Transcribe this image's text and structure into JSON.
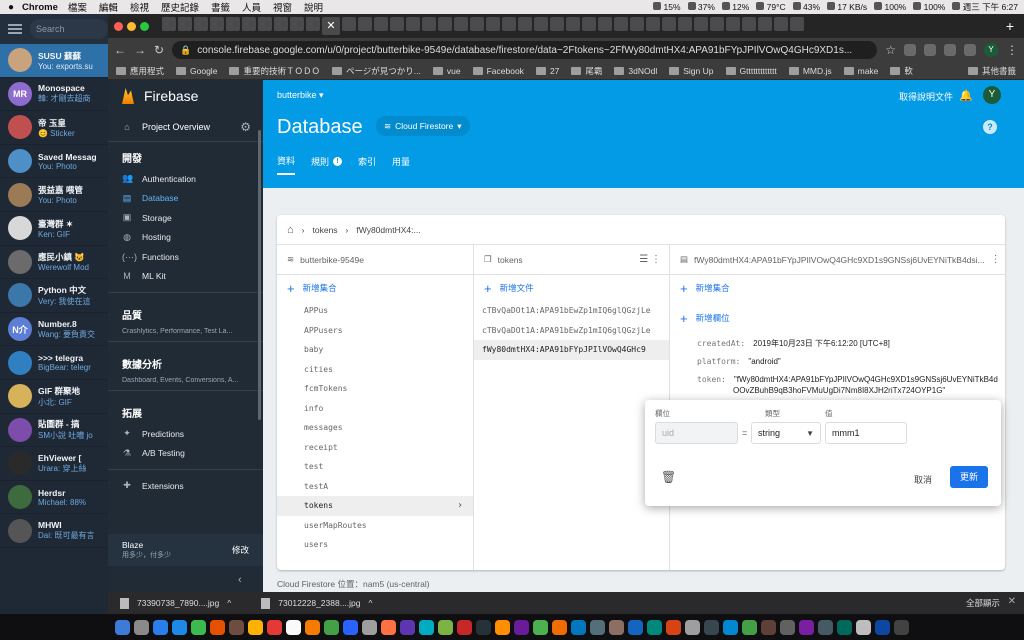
{
  "menubar": {
    "app_name": "Chrome",
    "menus": [
      "檔案",
      "編輯",
      "檢視",
      "歷史記錄",
      "書籤",
      "人員",
      "視窗",
      "說明"
    ],
    "status": [
      "15%",
      "37%",
      "12%",
      "79°C",
      "43%",
      "17 KB/s",
      "100%",
      "100%",
      "週三 下午 6:27"
    ]
  },
  "telegram": {
    "search_placeholder": "Search",
    "chats": [
      {
        "name": "SUSU 蘇蘇",
        "preview": "You: exports.su",
        "avatar": "",
        "color": "#c9a27e",
        "active": true
      },
      {
        "name": "Monospace",
        "preview": "韓: 才剛去超商",
        "avatar": "MR",
        "color": "#8e6ccf",
        "active": false
      },
      {
        "name": "帝 玉皇",
        "preview": "😊 Sticker",
        "avatar": "",
        "color": "#c05050",
        "active": false
      },
      {
        "name": "Saved Messag",
        "preview": "You: Photo",
        "avatar": "",
        "color": "#4e8fc8",
        "active": false
      },
      {
        "name": "張益嘉 喂管",
        "preview": "You: Photo",
        "avatar": "",
        "color": "#9b7a55",
        "active": false
      },
      {
        "name": "臺灣群 ✶",
        "preview": "Ken: GIF",
        "avatar": "",
        "color": "#d8d8d8",
        "active": false
      },
      {
        "name": "應民小鎮 😺",
        "preview": "Werewolf Mod",
        "avatar": "",
        "color": "#6b6b6b",
        "active": false
      },
      {
        "name": "Python 中文",
        "preview": "Very: 我使在這",
        "avatar": "",
        "color": "#3b77a8",
        "active": false
      },
      {
        "name": "Number.8",
        "preview": "Wang: 要負責交",
        "avatar": "N介",
        "color": "#5d7ed6",
        "active": false
      },
      {
        "name": ">>> telegra",
        "preview": "BigBear: telegr",
        "avatar": "",
        "color": "#2f7fc1",
        "active": false
      },
      {
        "name": "GIF 群聚地",
        "preview": "小北: GIF",
        "avatar": "",
        "color": "#d6b25a",
        "active": false
      },
      {
        "name": "貼圖群 - 搞",
        "preview": "SM小說 吐嘈 jo",
        "avatar": "",
        "color": "#7c4dab",
        "active": false
      },
      {
        "name": "EhViewer [",
        "preview": "Urara: 穿上絲",
        "avatar": "",
        "color": "#2a2a2a",
        "active": false
      },
      {
        "name": "Herdsr",
        "preview": "Michael: 88%",
        "avatar": "",
        "color": "#3d6b3d",
        "active": false
      },
      {
        "name": "MHWI",
        "preview": "Dai: 既可最有言",
        "avatar": "",
        "color": "#555555",
        "active": false
      }
    ]
  },
  "chrome": {
    "url": "console.firebase.google.com/u/0/project/butterbike-9549e/database/firestore/data~2Ftokens~2FfWy80dmtHX4:APA91bFYpJPIlVOwQ4GHc9XD1s...",
    "bookmarks": [
      "應用程式",
      "Google",
      "重要的技術ＴＯＤＯ",
      "ページが見つかり...",
      "vue",
      "Facebook",
      "27",
      "尾霸",
      "3dNOdl",
      "Sign Up",
      "Gttttttttttttt",
      "MMD.js",
      "make",
      "軟"
    ],
    "other_bookmarks": "其他書籤",
    "profile_initial": "Y"
  },
  "firebase": {
    "brand": "Firebase",
    "project_overview": "Project Overview",
    "sections": [
      {
        "title": "開發",
        "subtitle": "",
        "items": [
          {
            "label": "Authentication",
            "icon": "people-icon",
            "glyph": "👥",
            "active": false
          },
          {
            "label": "Database",
            "icon": "database-icon",
            "glyph": "▤",
            "active": true
          },
          {
            "label": "Storage",
            "icon": "image-icon",
            "glyph": "▣",
            "active": false
          },
          {
            "label": "Hosting",
            "icon": "globe-icon",
            "glyph": "◍",
            "active": false
          },
          {
            "label": "Functions",
            "icon": "functions-icon",
            "glyph": "(···)",
            "active": false
          },
          {
            "label": "ML Kit",
            "icon": "mlkit-icon",
            "glyph": "M",
            "active": false
          }
        ]
      },
      {
        "title": "品質",
        "subtitle": "Crashlytics, Performance, Test La...",
        "items": []
      },
      {
        "title": "數據分析",
        "subtitle": "Dashboard, Events, Conversions, A...",
        "items": []
      },
      {
        "title": "拓展",
        "subtitle": "",
        "items": [
          {
            "label": "Predictions",
            "icon": "predictions-icon",
            "glyph": "✦",
            "active": false
          },
          {
            "label": "A/B Testing",
            "icon": "flask-icon",
            "glyph": "⚗",
            "active": false
          }
        ]
      }
    ],
    "extensions": "Extensions",
    "plan": {
      "name": "Blaze",
      "desc": "用多少，付多少",
      "modify": "修改"
    },
    "project_name": "butterbike",
    "docs_link": "取得說明文件",
    "user_initial": "Y",
    "page_title": "Database",
    "db_selector": "Cloud Firestore",
    "tabs": [
      "資料",
      "規則",
      "索引",
      "用量"
    ],
    "breadcrumb": [
      "tokens",
      "fWy80dmtHX4:..."
    ],
    "columns": {
      "root": {
        "title": "butterbike-9549e",
        "add_label": "新增集合",
        "collections": [
          "APPus",
          "APPusers",
          "baby",
          "cities",
          "fcmTokens",
          "info",
          "messages",
          "receipt",
          "test",
          "testA",
          "tokens",
          "userMapRoutes",
          "users"
        ],
        "selected": "tokens"
      },
      "collection": {
        "title": "tokens",
        "add_label": "新增文件",
        "documents": [
          "cTBvQaDOt1A:APA91bEwZp1mIQ6glQGzjLe",
          "cTBvQaDOt1A:APA91bEwZp1mIQ6glQGzjLe",
          "fWy80dmtHX4:APA91bFYpJPIlVOwQ4GHc9"
        ],
        "selected_index": 2
      },
      "document": {
        "title": "fWy80dmtHX4:APA91bFYpJPIlVOwQ4GHc9XD1s9GNSsj6UvEYNiTkB4dsi...",
        "add_collection": "新增集合",
        "add_field": "新增欄位",
        "fields": [
          {
            "key": "createdAt:",
            "value": "2019年10月23日 下午6:12:20 [UTC+8]"
          },
          {
            "key": "platform:",
            "value": "\"android\""
          },
          {
            "key": "token:",
            "value": "\"fWy80dmtHX4:APA91bFYpJPIlVOwQ4GHc9XD1s9GNSsj6UvEYNiTkB4d"
          }
        ],
        "token_cont": "OOvZBuhB9qB3hoFVMuUgDi7Nm8I8XJH2riTx724OYP1G\""
      }
    },
    "editor": {
      "field_label": "欄位",
      "type_label": "類型",
      "value_label": "值",
      "field_placeholder": "uid",
      "type_value": "string",
      "value_value": "mmm1",
      "cancel": "取消",
      "update": "更新"
    },
    "footer": "Cloud Firestore 位置：nam5 (us-central)"
  },
  "downloads": [
    {
      "name": "73390738_7890....jpg"
    },
    {
      "name": "73012228_2388....jpg"
    }
  ],
  "show_all": "全部顯示",
  "dock_colors": [
    "#3d7bd9",
    "#8a8a8a",
    "#2b7de9",
    "#1e88e5",
    "#3dba4e",
    "#e65100",
    "#6d4c41",
    "#ffb300",
    "#e53935",
    "#fafafa",
    "#f57c00",
    "#43a047",
    "#2962ff",
    "#9e9e9e",
    "#ff7043",
    "#5e35b1",
    "#00acc1",
    "#7cb342",
    "#c62828",
    "#263238",
    "#ff8f00",
    "#6a1b9a",
    "#4caf50",
    "#ef6c00",
    "#0277bd",
    "#546e7a",
    "#8d6e63",
    "#1565c0",
    "#00897b",
    "#d84315",
    "#9e9e9e",
    "#37474f",
    "#0288d1",
    "#43a047",
    "#5d4037",
    "#616161",
    "#7b1fa2",
    "#455a64",
    "#00695c",
    "#bdbdbd",
    "#0d47a1",
    "#424242"
  ]
}
